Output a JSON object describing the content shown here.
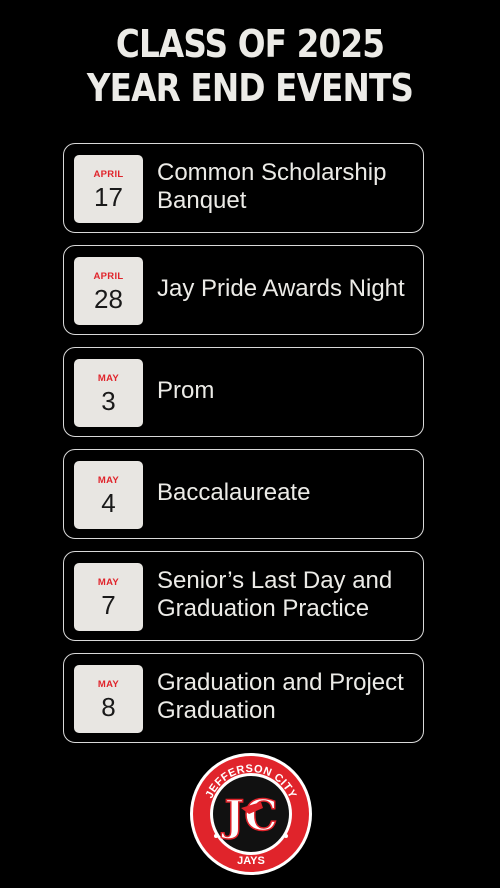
{
  "title": {
    "line1": "CLASS OF 2025",
    "line2": "YEAR END EVENTS"
  },
  "events": [
    {
      "month": "APRIL",
      "day": "17",
      "name": "Common Scholarship Banquet"
    },
    {
      "month": "APRIL",
      "day": "28",
      "name": "Jay Pride Awards Night"
    },
    {
      "month": "MAY",
      "day": "3",
      "name": "Prom"
    },
    {
      "month": "MAY",
      "day": "4",
      "name": "Baccalaureate"
    },
    {
      "month": "MAY",
      "day": "7",
      "name": "Senior’s Last Day and Graduation Practice"
    },
    {
      "month": "MAY",
      "day": "8",
      "name": "Graduation and Project Graduation"
    }
  ],
  "logo": {
    "top_text": "JEFFERSON CITY",
    "bottom_text": "JAYS",
    "monogram": "JC"
  },
  "colors": {
    "background": "#000000",
    "accent": "#e0242b",
    "card_border": "#d9d9d9",
    "date_box": "#e8e6e2",
    "text": "#ecebe7"
  }
}
